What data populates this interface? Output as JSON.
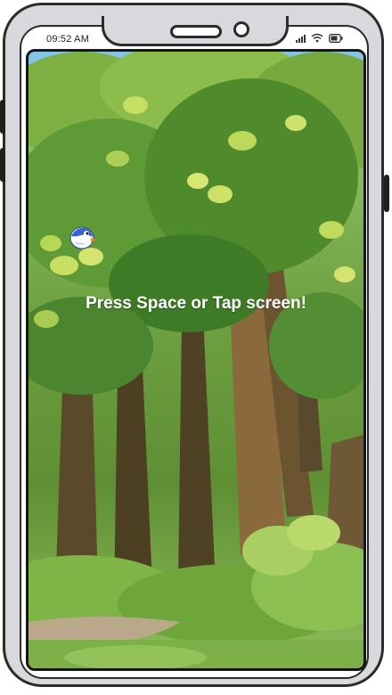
{
  "status_bar": {
    "time": "09:52 AM",
    "icons": [
      "signal-icon",
      "wifi-icon",
      "battery-icon"
    ]
  },
  "game": {
    "prompt": "Press Space or Tap screen!",
    "player": "bird-icon",
    "background": "forest"
  },
  "colors": {
    "prompt_text": "#ffffff",
    "bird_body": "#3a63d6",
    "bird_beak": "#f08a24"
  }
}
